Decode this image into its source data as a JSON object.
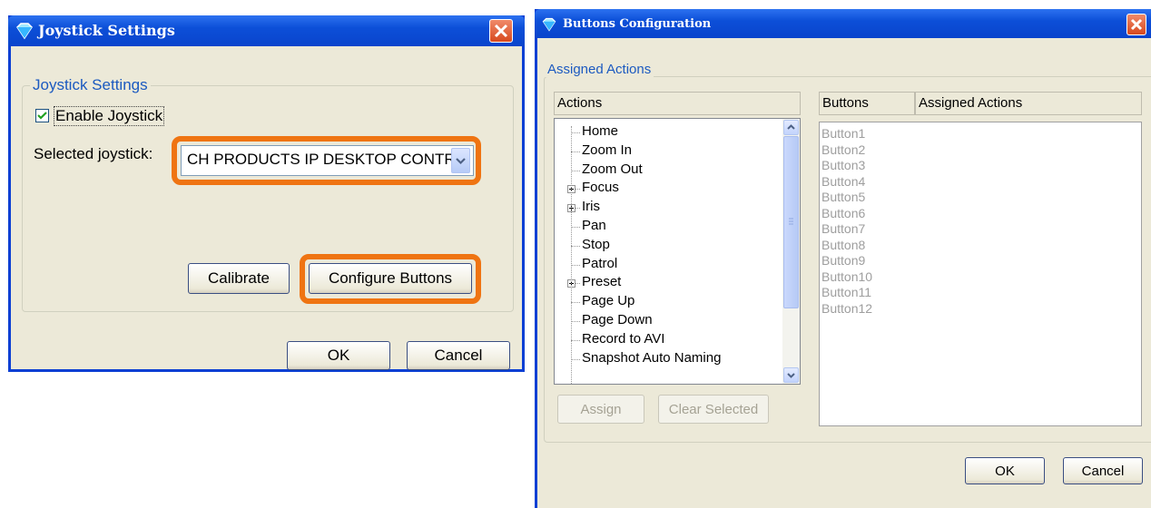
{
  "joystick_window": {
    "title": "Joystick Settings",
    "group_label": "Joystick Settings",
    "enable_label": "Enable Joystick",
    "enable_checked": true,
    "selected_label": "Selected joystick:",
    "selected_value": "CH PRODUCTS IP DESKTOP CONTROLLER",
    "calibrate_label": "Calibrate",
    "configure_label": "Configure Buttons",
    "ok_label": "OK",
    "cancel_label": "Cancel"
  },
  "buttons_window": {
    "title": "Buttons Configuration",
    "group_label": "Assigned Actions",
    "actions_header": "Actions",
    "buttons_header": "Buttons",
    "assigned_header": "Assigned Actions",
    "actions": [
      {
        "label": "Home",
        "expandable": false
      },
      {
        "label": "Zoom In",
        "expandable": false
      },
      {
        "label": "Zoom Out",
        "expandable": false
      },
      {
        "label": "Focus",
        "expandable": true
      },
      {
        "label": "Iris",
        "expandable": true
      },
      {
        "label": "Pan",
        "expandable": false
      },
      {
        "label": "Stop",
        "expandable": false
      },
      {
        "label": "Patrol",
        "expandable": false
      },
      {
        "label": "Preset",
        "expandable": true
      },
      {
        "label": "Page Up",
        "expandable": false
      },
      {
        "label": "Page Down",
        "expandable": false
      },
      {
        "label": "Record to AVI",
        "expandable": false
      },
      {
        "label": "Snapshot Auto Naming",
        "expandable": false
      }
    ],
    "buttons": [
      "Button1",
      "Button2",
      "Button3",
      "Button4",
      "Button5",
      "Button6",
      "Button7",
      "Button8",
      "Button9",
      "Button10",
      "Button11",
      "Button12"
    ],
    "assign_label": "Assign",
    "clear_label": "Clear Selected",
    "ok_label": "OK",
    "cancel_label": "Cancel"
  },
  "colors": {
    "highlight": "#ef7412",
    "titlebar": "#0a44cc",
    "dialog_bg": "#ece9d8"
  }
}
